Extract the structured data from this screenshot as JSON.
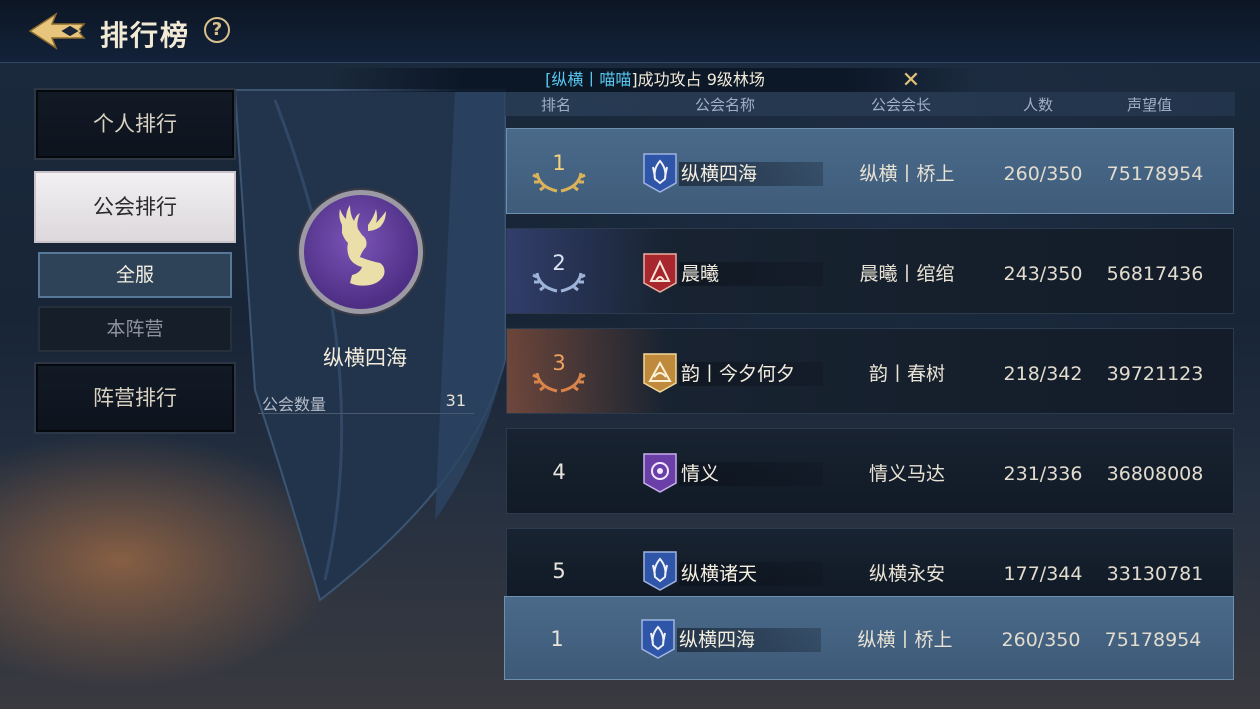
{
  "header": {
    "title": "排行榜",
    "help_label": "?"
  },
  "banner": {
    "prefix": "[",
    "name": "纵横丨喵喵",
    "suffix": "]成功攻占 9级林场"
  },
  "nav": {
    "personal": "个人排行",
    "guild": "公会排行",
    "server_all": "全服",
    "own_camp": "本阵营",
    "camp": "阵营排行"
  },
  "guild_info": {
    "name": "纵横四海",
    "count_label": "公会数量",
    "count_value": "31"
  },
  "table": {
    "headers": [
      "排名",
      "公会名称",
      "公会会长",
      "人数",
      "声望值"
    ],
    "rows": [
      {
        "rank": "1",
        "name": "纵横四海",
        "leader": "纵横丨桥上",
        "members": "260/350",
        "prestige": "75178954"
      },
      {
        "rank": "2",
        "name": "晨曦",
        "leader": "晨曦丨绾绾",
        "members": "243/350",
        "prestige": "56817436"
      },
      {
        "rank": "3",
        "name": "韵丨今夕何夕",
        "leader": "韵丨春树",
        "members": "218/342",
        "prestige": "39721123"
      },
      {
        "rank": "4",
        "name": "情义",
        "leader": "情义马达",
        "members": "231/336",
        "prestige": "36808008"
      },
      {
        "rank": "5",
        "name": "纵横诸天",
        "leader": "纵横永安",
        "members": "177/344",
        "prestige": "33130781"
      }
    ],
    "self_row": {
      "rank": "1",
      "name": "纵横四海",
      "leader": "纵横丨桥上",
      "members": "260/350",
      "prestige": "75178954"
    }
  },
  "colors": {
    "gold": "#d9b25a",
    "silver": "#9fb3d8",
    "bronze": "#d9844a",
    "highlight": "#57c9f0"
  }
}
